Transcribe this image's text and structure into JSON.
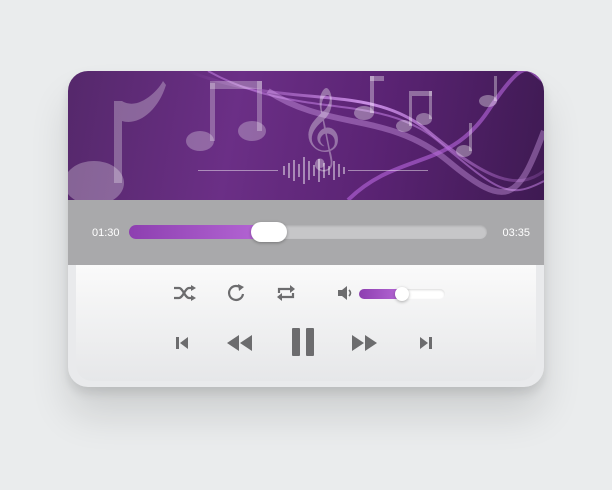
{
  "player": {
    "elapsed_time": "01:30",
    "total_time": "03:35",
    "progress_fraction": 0.39,
    "volume_fraction": 0.5,
    "accent_color": "#9a4cc0",
    "art_color": "#5f2a78"
  },
  "controls": {
    "row1": [
      "shuffle-icon",
      "replay-icon",
      "repeat-icon",
      "volume-icon"
    ],
    "row2": [
      "skip-previous-icon",
      "rewind-icon",
      "pause-icon",
      "fast-forward-icon",
      "skip-next-icon"
    ]
  }
}
